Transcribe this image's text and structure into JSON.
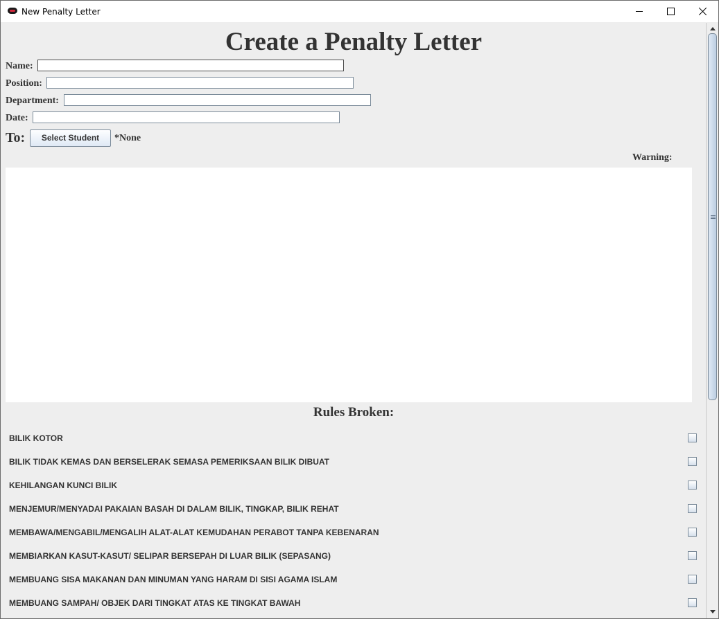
{
  "window": {
    "title": "New Penalty Letter",
    "controls": [
      "minimize-icon",
      "maximize-icon",
      "close-icon"
    ]
  },
  "form": {
    "heading": "Create a Penalty Letter",
    "fields": {
      "name_label": "Name:",
      "name_value": "",
      "position_label": "Position:",
      "position_value": "",
      "department_label": "Department:",
      "department_value": "",
      "date_label": "Date:",
      "date_value": ""
    },
    "to_label": "To:",
    "select_student_label": "Select Student",
    "selected_student": "*None",
    "warning_label": "Warning:",
    "warning_text": ""
  },
  "rules": {
    "heading": "Rules Broken:",
    "items": [
      {
        "label": "BILIK KOTOR",
        "checked": false
      },
      {
        "label": "BILIK TIDAK KEMAS DAN BERSELERAK SEMASA PEMERIKSAAN BILIK DIBUAT",
        "checked": false
      },
      {
        "label": "KEHILANGAN KUNCI BILIK",
        "checked": false
      },
      {
        "label": "MENJEMUR/MENYADAI PAKAIAN BASAH DI DALAM BILIK, TINGKAP, BILIK REHAT",
        "checked": false
      },
      {
        "label": "MEMBAWA/MENGABIL/MENGALIH ALAT-ALAT KEMUDAHAN PERABOT TANPA KEBENARAN",
        "checked": false
      },
      {
        "label": "MEMBIARKAN KASUT-KASUT/ SELIPAR BERSEPAH DI LUAR BILIK (SEPASANG)",
        "checked": false
      },
      {
        "label": "MEMBUANG SISA MAKANAN DAN MINUMAN YANG HARAM DI SISI AGAMA ISLAM",
        "checked": false
      },
      {
        "label": "MEMBUANG SAMPAH/ OBJEK DARI TINGKAT ATAS KE TINGKAT BAWAH",
        "checked": false
      }
    ]
  },
  "scrollbar": {
    "position_fraction": 0.0
  }
}
